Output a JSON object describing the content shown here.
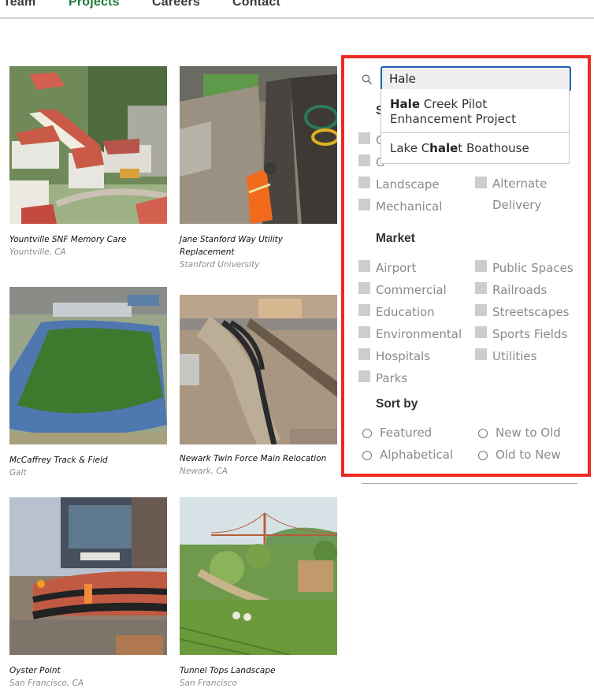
{
  "nav": {
    "items": [
      {
        "label": "Team",
        "active": false
      },
      {
        "label": "Projects",
        "active": true
      },
      {
        "label": "Careers",
        "active": false
      },
      {
        "label": "Contact",
        "active": false
      }
    ],
    "active_color": "#1d7a3a"
  },
  "projects": [
    {
      "title": "Yountville SNF Memory Care",
      "location": "Yountville, CA",
      "image": "aerial rendering of hospital campus with red roofs"
    },
    {
      "title": "Jane Stanford Way Utility Replacement",
      "location": "Stanford University",
      "image": "worker in orange vest in utility trench"
    },
    {
      "title": "McCaffrey Track & Field",
      "location": "Galt",
      "image": "aerial view of green field with blue running track"
    },
    {
      "title": "Newark Twin Force Main Relocation",
      "location": "Newark, CA",
      "image": "large black pipes laid along dirt trench"
    },
    {
      "title": "Oyster Point",
      "location": "San Francisco, CA",
      "image": "construction site with glass building and curved retaining walls"
    },
    {
      "title": "Tunnel Tops Landscape",
      "location": "San Francisco",
      "image": "park rendering with Golden Gate Bridge in background"
    }
  ],
  "filter": {
    "search": {
      "value": "Hale",
      "icon": "search-icon"
    },
    "autocomplete": [
      {
        "pre": "",
        "match": "Hale",
        "post": " Creek Pilot Enhancement Project"
      },
      {
        "pre": "Lake C",
        "match": "hale",
        "post": "t Boathouse"
      }
    ],
    "service": {
      "title_visible": "S",
      "left": [
        "C",
        "G",
        "Landscape",
        "Mechanical"
      ],
      "right": [
        "",
        "",
        "Alternate Delivery"
      ]
    },
    "market": {
      "title": "Market",
      "left": [
        "Airport",
        "Commercial",
        "Education",
        "Environmental",
        "Hospitals",
        "Parks"
      ],
      "right": [
        "Public Spaces",
        "Railroads",
        "Streetscapes",
        "Sports Fields",
        "Utilities"
      ]
    },
    "sort": {
      "title": "Sort by",
      "options": [
        "Featured",
        "New to Old",
        "Alphabetical",
        "Old to New"
      ]
    },
    "highlight_color": "#ee2a24"
  }
}
